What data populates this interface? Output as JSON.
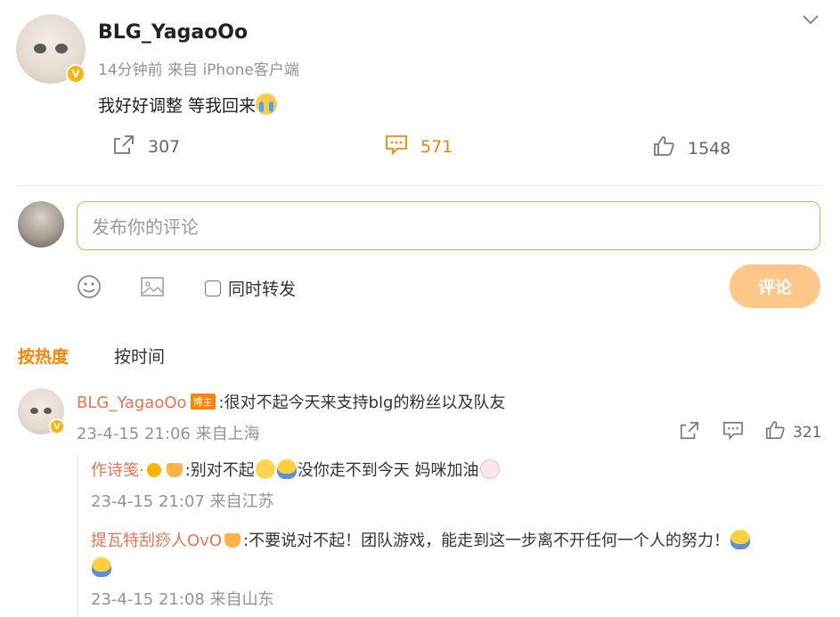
{
  "post": {
    "username": "BLG_YagaoOo",
    "meta": "14分钟前 来自 iPhone客户端",
    "content": "我好好调整 等我回来",
    "stats": {
      "reposts": "307",
      "comments": "571",
      "likes": "1548"
    }
  },
  "composer": {
    "placeholder": "发布你的评论",
    "repost_label": "同时转发",
    "submit_label": "评论"
  },
  "sort": {
    "hot": "按热度",
    "time": "按时间"
  },
  "comments": [
    {
      "author": "BLG_YagaoOo",
      "tag": "博主",
      "text": ":很对不起今天来支持blg的粉丝以及队友",
      "meta": "23-4-15 21:06 来自上海",
      "likes": "321",
      "replies": [
        {
          "author": "作诗笺·",
          "text_a": ":别对不起",
          "text_b": "没你走不到今天 妈咪加油",
          "meta": "23-4-15 21:07 来自江苏"
        },
        {
          "author": "提瓦特刮痧人OvO",
          "text_a": ":不要说对不起！团队游戏，能走到这一步离不开任何一个人的努力！",
          "meta": "23-4-15 21:08 来自山东"
        }
      ]
    }
  ],
  "colors": {
    "accent": "#ff8200",
    "author": "#eb7350",
    "input_border": "#f5a84a",
    "submit_bg": "#ffc88a",
    "badge": "#ffb300"
  },
  "icons": [
    "chevron-down-icon",
    "verified-badge-icon",
    "repost-icon",
    "comment-icon",
    "like-icon",
    "emoji-icon",
    "image-icon"
  ]
}
